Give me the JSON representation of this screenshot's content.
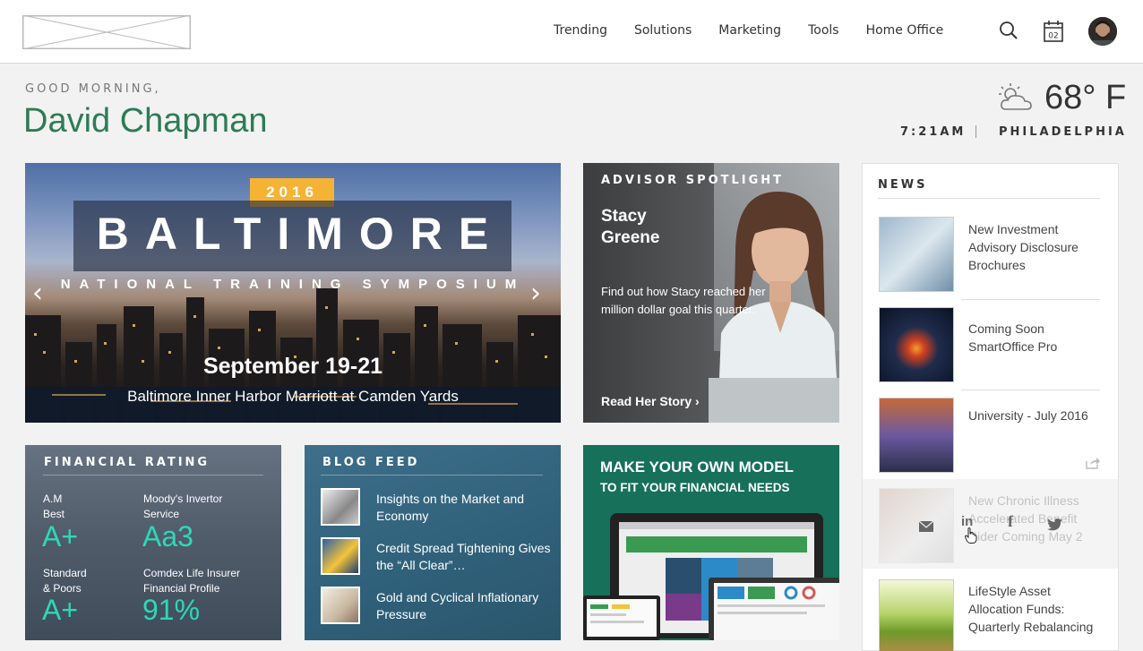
{
  "nav": {
    "items": [
      "Trending",
      "Solutions",
      "Marketing",
      "Tools",
      "Home Office"
    ],
    "calendar_day": "02"
  },
  "greeting": {
    "subtitle": "GOOD MORNING,",
    "name": "David Chapman"
  },
  "weather": {
    "temperature": "68° F",
    "time": "7:21AM",
    "city": "PHILADELPHIA"
  },
  "hero": {
    "year": "2016",
    "title": "BALTIMORE",
    "subtitle": "NATIONAL TRAINING SYMPOSIUM",
    "date": "September 19-21",
    "venue": "Baltimore Inner Harbor Marriott at Camden Yards",
    "prev": "‹",
    "next": "›"
  },
  "advisor": {
    "label": "ADVISOR SPOTLIGHT",
    "name": "Stacy Greene",
    "description": "Find out how Stacy reached her million dollar goal this quarter.",
    "link": "Read Her Story ›"
  },
  "financial": {
    "label": "FINANCIAL RATING",
    "ratings": [
      {
        "label": "A.M\nBest",
        "value": "A+"
      },
      {
        "label": "Moody's Invertor\nService",
        "value": "Aa3"
      },
      {
        "label": "Standard\n& Poors",
        "value": "A+"
      },
      {
        "label": "Comdex Life Insurer\nFinancial Profile",
        "value": "91%"
      }
    ]
  },
  "blog": {
    "label": "BLOG FEED",
    "items": [
      "Insights on the Market and Economy",
      "Credit Spread Tightening Gives the “All Clear”…",
      "Gold and Cyclical Inflationary Pressure"
    ]
  },
  "model": {
    "heading1": "MAKE YOUR OWN MODEL",
    "heading2": "TO FIT YOUR FINANCIAL NEEDS"
  },
  "news": {
    "title": "NEWS",
    "items": [
      "New  Investment Advisory Disclosure Brochures",
      "Coming Soon SmartOffice Pro",
      "University - July 2016",
      "New Chronic Illness Accelerated Benefit Rider Coming May 2",
      "LifeStyle Asset Allocation Funds: Quarterly Rebalancing"
    ],
    "share_icons": [
      "mail-icon",
      "linkedin-icon",
      "facebook-icon",
      "twitter-icon",
      "share-icon"
    ]
  },
  "colors": {
    "accent_green": "#2e7b56",
    "rating_teal": "#2ed8b7",
    "year_badge": "#f5b335",
    "model_green": "#16705a"
  }
}
